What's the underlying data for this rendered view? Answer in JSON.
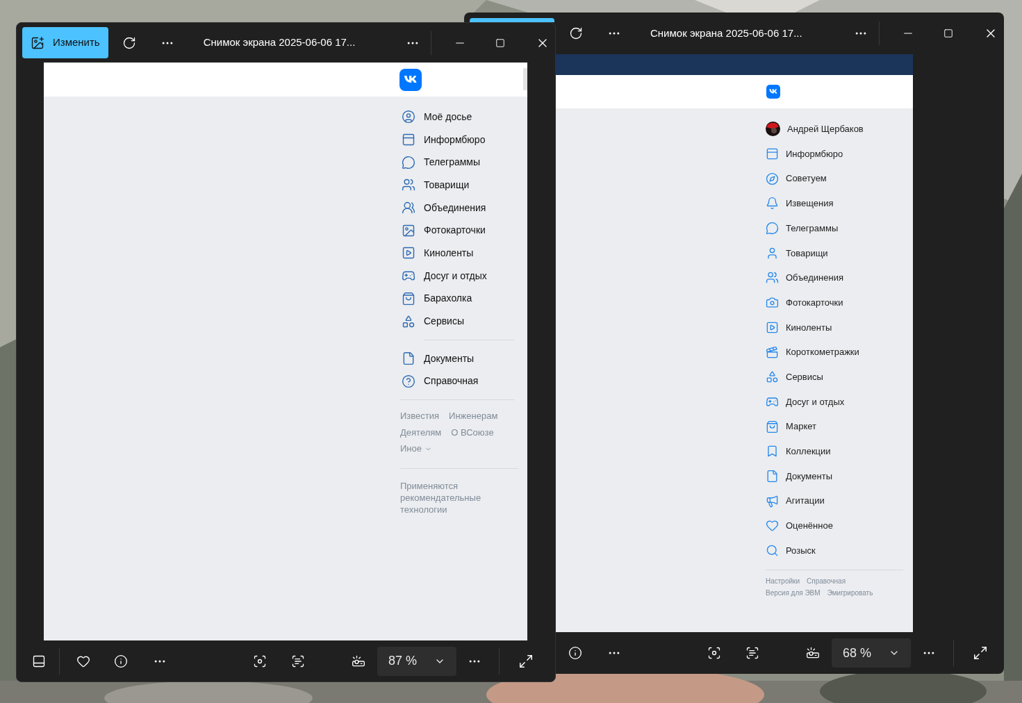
{
  "back_window": {
    "title": "Снимок экрана 2025-06-06 17...",
    "zoom": "68 %",
    "page": {
      "profile_name": "Андрей Щербаков",
      "menu": [
        "Информбюро",
        "Советуем",
        "Извещения",
        "Телеграммы",
        "Товарищи",
        "Объединения",
        "Фотокарточки",
        "Киноленты",
        "Короткометражки",
        "Сервисы",
        "Досуг и отдых",
        "Маркет",
        "Коллекции",
        "Документы",
        "Агитации",
        "Оценённое",
        "Розыск"
      ],
      "footer_links": [
        [
          "Настройки",
          "Справочная"
        ],
        [
          "Версия для ЭВМ",
          "Эмигрировать"
        ]
      ]
    }
  },
  "front_window": {
    "edit_button": "Изменить",
    "title": "Снимок экрана 2025-06-06 17...",
    "zoom": "87 %",
    "page": {
      "menu": [
        "Моё досье",
        "Информбюро",
        "Телеграммы",
        "Товарищи",
        "Объединения",
        "Фотокарточки",
        "Киноленты",
        "Досуг и отдых",
        "Барахолка",
        "Сервисы"
      ],
      "menu_secondary": [
        "Документы",
        "Справочная"
      ],
      "footer_links": [
        [
          "Известия",
          "Инженерам"
        ],
        [
          "Деятелям",
          "О ВСоюзе"
        ]
      ],
      "more_link": "Иное",
      "note": "Применяются рекомендательные технологии"
    }
  }
}
